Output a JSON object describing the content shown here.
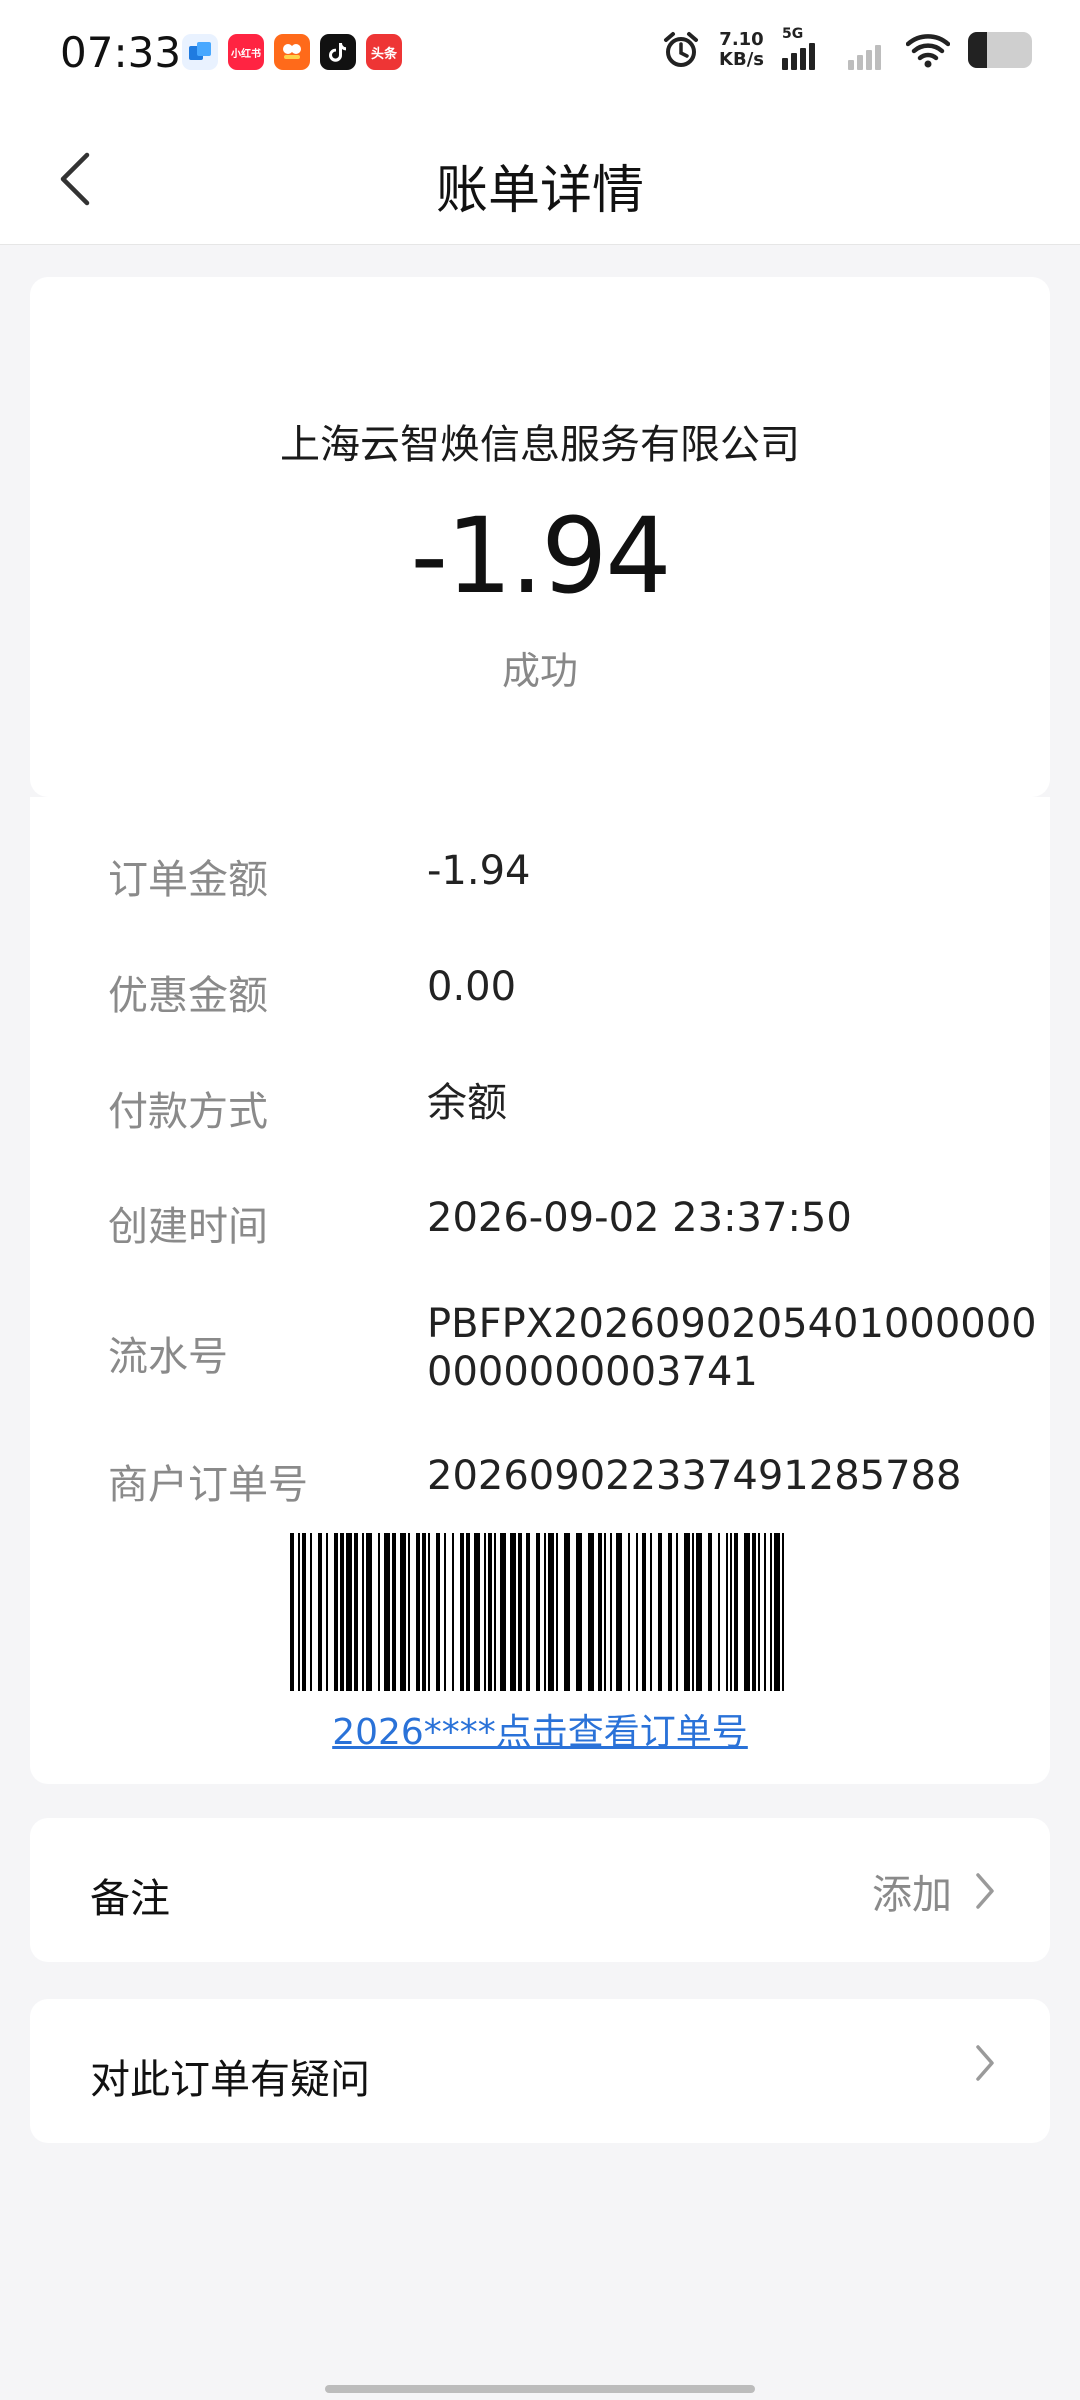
{
  "status_bar": {
    "time": "07:33",
    "notifications": [
      {
        "icon": "app-blue-icon",
        "color": "#1f7be0"
      },
      {
        "icon": "xiaohongshu-icon",
        "label": "小红书",
        "color": "#ff2442"
      },
      {
        "icon": "orange-app-icon",
        "color": "#ff6a1a"
      },
      {
        "icon": "tiktok-icon",
        "color": "#111111"
      },
      {
        "icon": "toutiao-icon",
        "label": "头条",
        "color": "#ee3535"
      }
    ],
    "net_speed_value": "7.10",
    "net_speed_unit": "KB/s",
    "network_type": "5G",
    "battery_level": 0.3
  },
  "header": {
    "title": "账单详情"
  },
  "summary": {
    "merchant": "上海云智焕信息服务有限公司",
    "amount": "-1.94",
    "status": "成功"
  },
  "details": [
    {
      "label": "订单金额",
      "value": "-1.94"
    },
    {
      "label": "优惠金额",
      "value": "0.00"
    },
    {
      "label": "付款方式",
      "value": "余额"
    },
    {
      "label": "创建时间",
      "value": "2026-09-02 23:37:50"
    },
    {
      "label": "流水号",
      "value": "PBFPX20260902054010000000000000003741"
    },
    {
      "label": "商户订单号",
      "value": "20260902233749128578​8"
    }
  ],
  "barcode_link": "2026****点击查看订单号",
  "remark": {
    "label": "备注",
    "action": "添加"
  },
  "question": {
    "label": "对此订单有疑问"
  },
  "colors": {
    "link": "#2a72d8",
    "background": "#f5f5f7"
  }
}
